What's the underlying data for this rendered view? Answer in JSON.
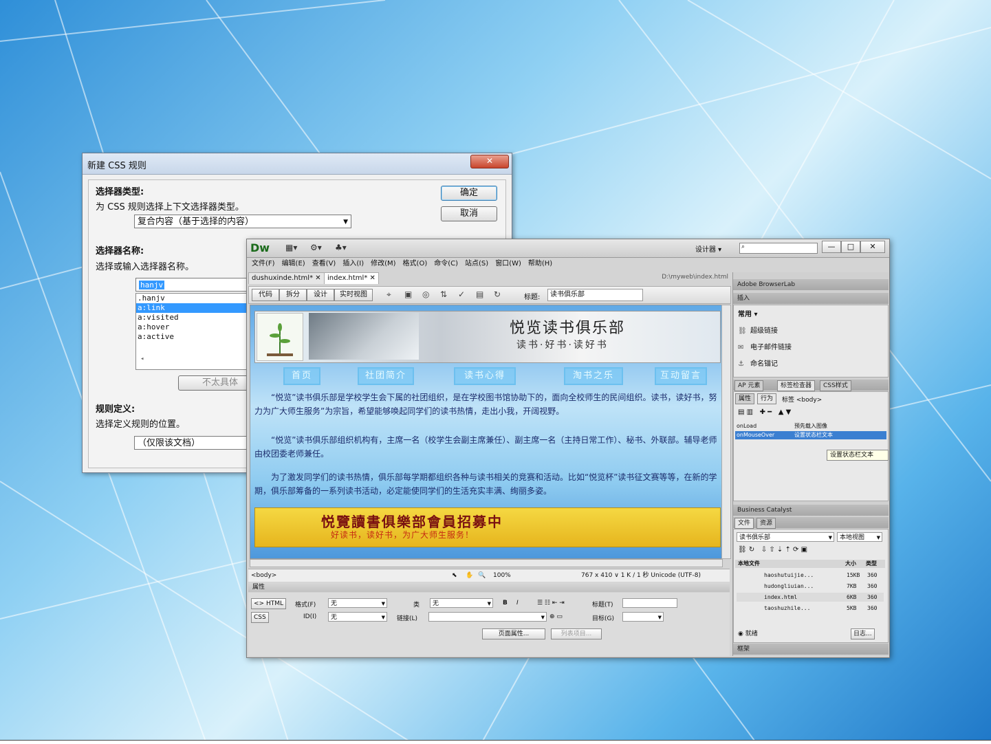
{
  "dialog": {
    "title": "新建 CSS 规则",
    "close": "✕",
    "selector_type_heading": "选择器类型:",
    "selector_type_desc": "为 CSS 规则选择上下文选择器类型。",
    "selector_type_value": "复合内容（基于选择的内容）",
    "selector_name_heading": "选择器名称:",
    "selector_name_desc": "选择或输入选择器名称。",
    "selector_input_value": "hanjv",
    "selector_options": [
      ".hanjv",
      "a:link",
      "a:visited",
      "a:hover",
      "a:active"
    ],
    "selected_option_index": 1,
    "less_specific": "不太具体",
    "rule_def_heading": "规则定义:",
    "rule_def_desc": "选择定义规则的位置。",
    "rule_def_value": "（仅限该文档）",
    "ok": "确定",
    "cancel": "取消"
  },
  "dw": {
    "logo": "Dw",
    "workspace": "设计器",
    "menu": [
      "文件(F)",
      "编辑(E)",
      "查看(V)",
      "插入(I)",
      "修改(M)",
      "格式(O)",
      "命令(C)",
      "站点(S)",
      "窗口(W)",
      "帮助(H)"
    ],
    "doc_tabs": [
      "dushuxinde.html*",
      "index.html*"
    ],
    "doc_path": "D:\\myweb\\index.html",
    "view_buttons": [
      "代码",
      "拆分",
      "设计",
      "实时视图"
    ],
    "title_label": "标题:",
    "title_value": "读书俱乐部",
    "page": {
      "banner_title": "悦览读书俱乐部",
      "banner_sub": "读书·好书·读好书",
      "nav": [
        "首页",
        "社团简介",
        "读书心得",
        "淘书之乐",
        "互动留言"
      ],
      "para1": "“悦览”读书俱乐部是学校学生会下属的社团组织，是在学校图书馆协助下的，面向全校师生的民间组织。读书，读好书，努力为广大师生服务”为宗旨，希望能够唤起同学们的读书热情，走出小我，开阔视野。",
      "para2": "“悦览”读书俱乐部组织机构有，主席一名（校学生会副主席兼任）、副主席一名（主持日常工作）、秘书、外联部。辅导老师由校团委老师兼任。",
      "para3": "为了激发同学们的读书热情，俱乐部每学期都组织各种与读书相关的竞赛和活动。比如“悦览杯”读书征文赛等等，在新的学期，俱乐部筹备的一系列读书活动，必定能使同学们的生活充实丰满、绚丽多姿。",
      "recruit_title": "悦覽讀書俱樂部會員招募中",
      "recruit_sub": "好读书，读好书，为广大师生服务！"
    },
    "status": {
      "tag": "<body>",
      "zoom": "100%",
      "info": "767 x 410 ∨ 1 K / 1 秒 Unicode (UTF-8)"
    },
    "props": {
      "header": "属性",
      "html_btn": "<> HTML",
      "css_btn": "CSS",
      "format_label": "格式(F)",
      "format_value": "无",
      "class_label": "类",
      "class_value": "无",
      "id_label": "ID(I)",
      "id_value": "无",
      "link_label": "链接(L)",
      "title_label": "标题(T)",
      "target_label": "目标(G)",
      "page_props": "页面属性...",
      "list_item": "列表项目..."
    },
    "panels": {
      "browserlab": "Adobe BrowserLab",
      "insert": "插入",
      "insert_cat": "常用",
      "insert_items": [
        "超级链接",
        "电子邮件链接",
        "命名锚记"
      ],
      "tabs": [
        "AP 元素",
        "标签检查器",
        "CSS样式"
      ],
      "behav_tabs": [
        "属性",
        "行为"
      ],
      "tag_label": "标签 <body>",
      "events": [
        {
          "event": "onLoad",
          "action": "预先载入图像"
        },
        {
          "event": "onMouseOver",
          "action": "设置状态栏文本"
        }
      ],
      "tooltip": "设置状态栏文本",
      "bc": "Business Catalyst",
      "files_tabs": [
        "文件",
        "资源"
      ],
      "site": "读书俱乐部",
      "view": "本地视图",
      "local_files": "本地文件",
      "size": "大小",
      "type": "类型",
      "files": [
        {
          "name": "haoshutuijie...",
          "size": "15KB",
          "type": "360"
        },
        {
          "name": "hudongliuian...",
          "size": "7KB",
          "type": "360"
        },
        {
          "name": "index.html",
          "size": "6KB",
          "type": "360"
        },
        {
          "name": "taoshuzhile...",
          "size": "5KB",
          "type": "360"
        }
      ],
      "ready": "就绪",
      "log": "日志...",
      "footer": "框架"
    }
  },
  "colors": {
    "accent": "#3399ff",
    "dw_green": "#1b6b1b"
  }
}
